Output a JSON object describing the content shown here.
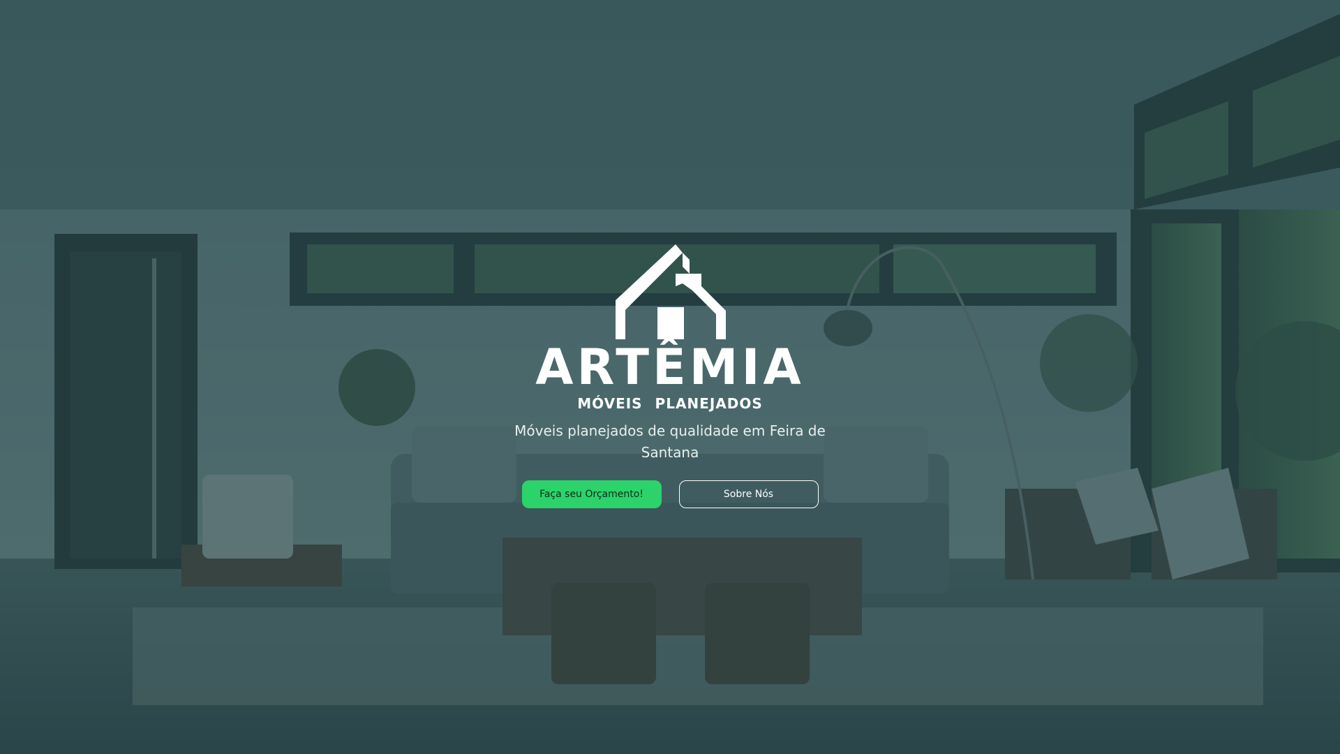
{
  "hero": {
    "logo": {
      "icon": "house-logo-icon",
      "wordmark": "ARTÊMIA",
      "tagline": "MÓVEIS PLANEJADOS"
    },
    "subtitle": "Móveis planejados de qualidade em Feira de Santana",
    "primary_button": "Faça seu Orçamento!",
    "secondary_button": "Sobre Nós"
  },
  "colors": {
    "overlay": "#1e4046",
    "accent": "#2bd36a",
    "text": "#ffffff"
  }
}
